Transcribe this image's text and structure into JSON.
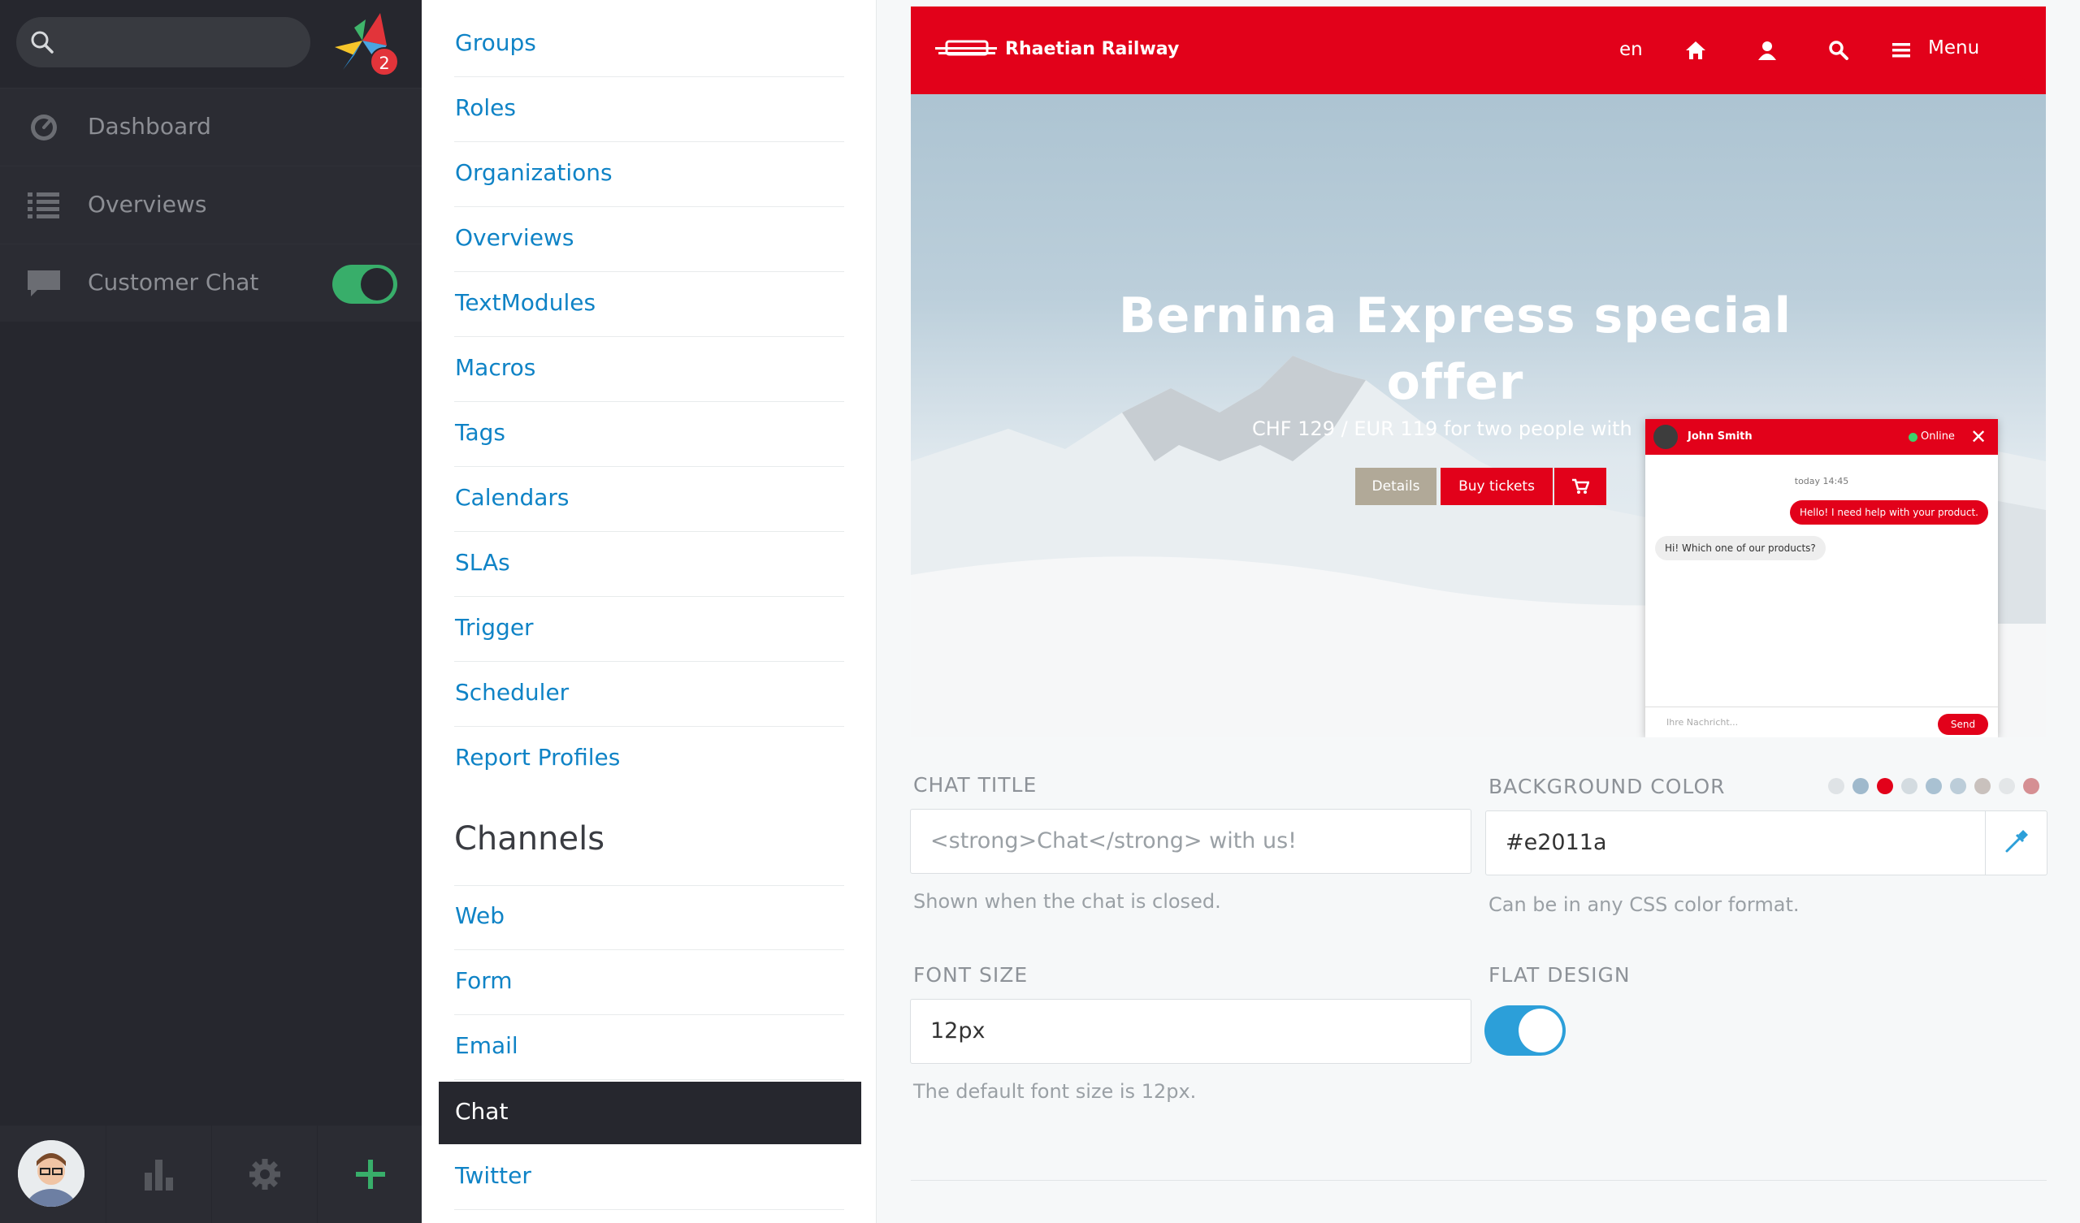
{
  "leftnav": {
    "search": {
      "placeholder": ""
    },
    "badge_count": "2",
    "items": [
      {
        "label": "Dashboard",
        "icon": "dashboard-icon"
      },
      {
        "label": "Overviews",
        "icon": "list-icon"
      },
      {
        "label": "Customer Chat",
        "icon": "chat-bubble-icon",
        "toggle": "on"
      }
    ],
    "bottom": [
      "avatar",
      "reports-icon",
      "settings-gear-icon",
      "add-plus-icon"
    ],
    "colors": {
      "bg": "#26272e",
      "toggle_on": "#38ae6a",
      "add": "#38ae6a"
    }
  },
  "menu": {
    "items": [
      "Groups",
      "Roles",
      "Organizations",
      "Overviews",
      "TextModules",
      "Macros",
      "Tags",
      "Calendars",
      "SLAs",
      "Trigger",
      "Scheduler",
      "Report Profiles"
    ],
    "channels_heading": "Channels",
    "channels": [
      "Web",
      "Form",
      "Email",
      "Chat",
      "Twitter"
    ],
    "active": "Chat",
    "link_color": "#0f83c6"
  },
  "preview": {
    "brand": "Rhaetian Railway",
    "lang": "en",
    "menu_label": "Menu",
    "hero_title": "Bernina Express special offer",
    "hero_sub": "CHF 129 / EUR 119 for two people with",
    "details_label": "Details",
    "buy_label": "Buy tickets",
    "brand_color": "#e2011a",
    "chat": {
      "agent": "John Smith",
      "status": "Online",
      "close": "✕",
      "time": "today 14:45",
      "msg_customer": "Hello! I need help with your product.",
      "msg_agent": "Hi! Which one of our products?",
      "input_placeholder": "Ihre Nachricht...",
      "send_label": "Send"
    }
  },
  "form": {
    "chat_title": {
      "label": "CHAT TITLE",
      "value": "<strong>Chat</strong> with us!",
      "help": "Shown when the chat is closed."
    },
    "background_color": {
      "label": "BACKGROUND COLOR",
      "value": "#e2011a",
      "help": "Can be in any CSS color format.",
      "swatches": [
        "#dfe3e6",
        "#9fb9cc",
        "#e2011a",
        "#d3dbe0",
        "#a9c1d2",
        "#bccdd9",
        "#c9c1bd",
        "#e3e6e8",
        "#d58f93"
      ]
    },
    "font_size": {
      "label": "FONT SIZE",
      "value": "12px",
      "help": "The default font size is 12px."
    },
    "flat_design": {
      "label": "FLAT DESIGN",
      "toggle": "on",
      "toggle_color": "#2c9fd9"
    }
  }
}
